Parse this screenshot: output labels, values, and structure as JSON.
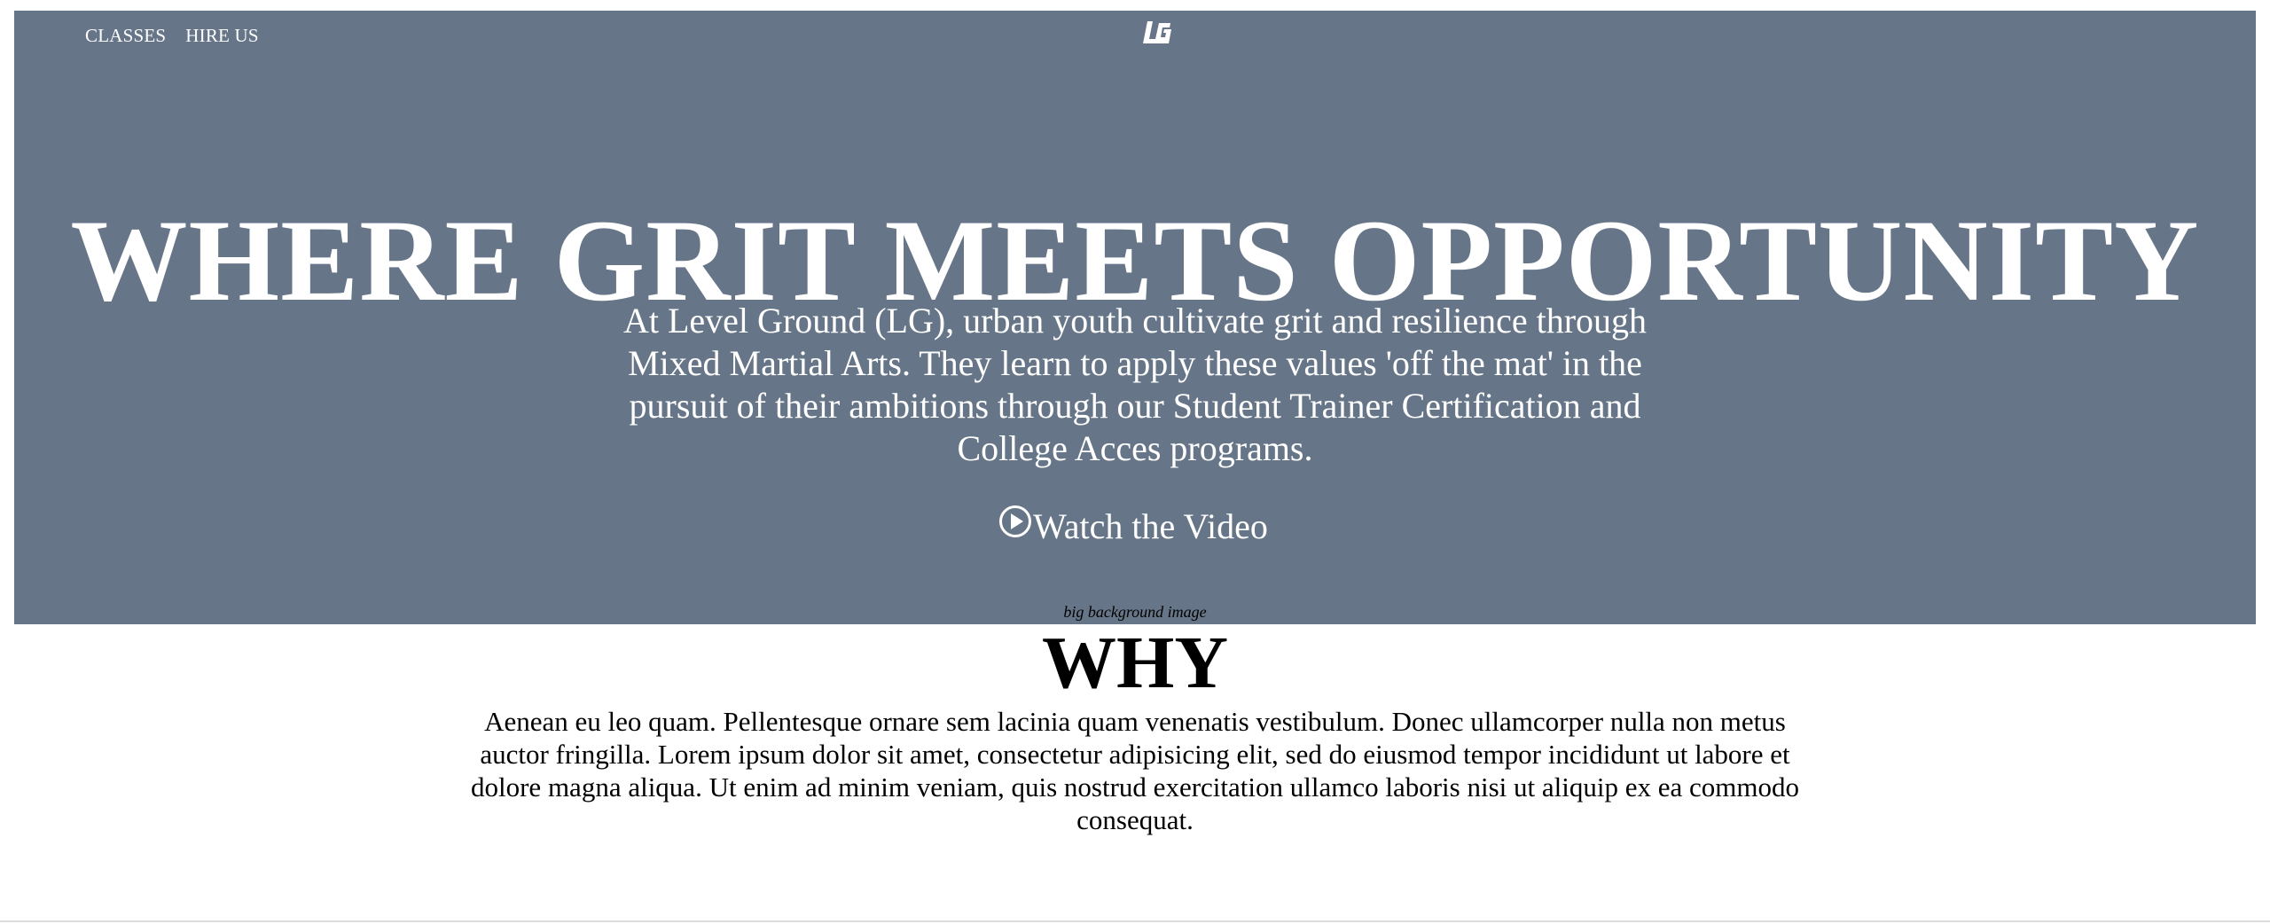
{
  "nav": {
    "items": [
      {
        "label": "CLASSES"
      },
      {
        "label": "HIRE US"
      }
    ]
  },
  "logo": {
    "text": "LG",
    "icon": "lg-logo-icon"
  },
  "hero": {
    "headline": "WHERE GRIT MEETS OPPORTUNITY",
    "intro": "At Level Ground (LG), urban youth cultivate grit and resilience through Mixed Martial Arts. They learn to apply these values 'off the mat' in the pursuit of their ambitions through our Student Trainer Certification and College Acces programs.",
    "video_link_label": "Watch the Video",
    "video_icon": "play-circle-icon",
    "background_color": "#667588"
  },
  "image_caption": "big background image",
  "why": {
    "title": "WHY",
    "text": "Aenean eu leo quam. Pellentesque ornare sem lacinia quam venenatis vestibulum. Donec ullamcorper nulla non metus auctor fringilla. Lorem ipsum dolor sit amet, consectetur adipisicing elit, sed do eiusmod tempor incididunt ut labore et dolore magna aliqua. Ut enim ad minim veniam, quis nostrud exercitation ullamco laboris nisi ut aliquip ex ea commodo consequat."
  }
}
